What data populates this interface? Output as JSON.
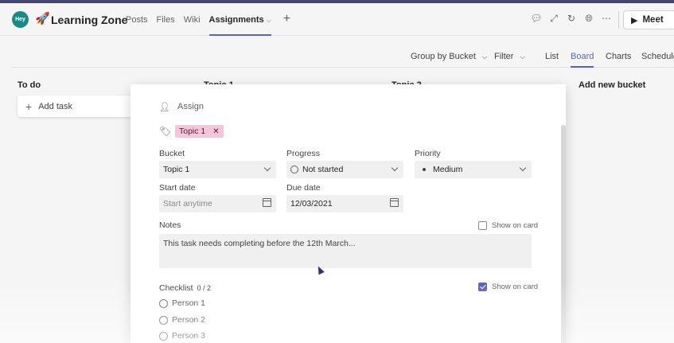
{
  "header": {
    "app_icon_text": "Hey",
    "team_name": "Learning Zone",
    "tabs": [
      {
        "label": "Posts"
      },
      {
        "label": "Files"
      },
      {
        "label": "Wiki"
      },
      {
        "label": "Assignments"
      }
    ],
    "meet_label": "Meet"
  },
  "toolbar": {
    "group_by_label": "Group by Bucket",
    "filter_label": "Filter",
    "views": [
      {
        "label": "List"
      },
      {
        "label": "Board"
      },
      {
        "label": "Charts"
      },
      {
        "label": "Schedule"
      }
    ],
    "active_view": "Board"
  },
  "board": {
    "buckets": [
      {
        "name": "To do"
      },
      {
        "name": "Topic 1"
      },
      {
        "name": "Topic 2"
      }
    ],
    "add_task_label": "Add task",
    "add_bucket_label": "Add new bucket"
  },
  "task_modal": {
    "assign_label": "Assign",
    "label_chip": "Topic 1",
    "bucket": {
      "label": "Bucket",
      "value": "Topic 1"
    },
    "progress": {
      "label": "Progress",
      "value": "Not started"
    },
    "priority": {
      "label": "Priority",
      "value": "Medium"
    },
    "start_date": {
      "label": "Start date",
      "placeholder": "Start anytime"
    },
    "due_date": {
      "label": "Due date",
      "value": "12/03/2021"
    },
    "notes": {
      "label": "Notes",
      "value": "This task needs completing before the 12th March...",
      "show_on_card_label": "Show on card",
      "show_on_card": false
    },
    "checklist": {
      "label": "Checklist",
      "count": "0 / 2",
      "show_on_card_label": "Show on card",
      "show_on_card": true,
      "items": [
        {
          "text": "Person 1"
        },
        {
          "text": "Person 2"
        },
        {
          "text": "Person 3"
        }
      ]
    }
  },
  "colors": {
    "accent": "#5b5fc7",
    "label_chip_bg": "#f4c6d9",
    "top_strip": "#464775"
  }
}
